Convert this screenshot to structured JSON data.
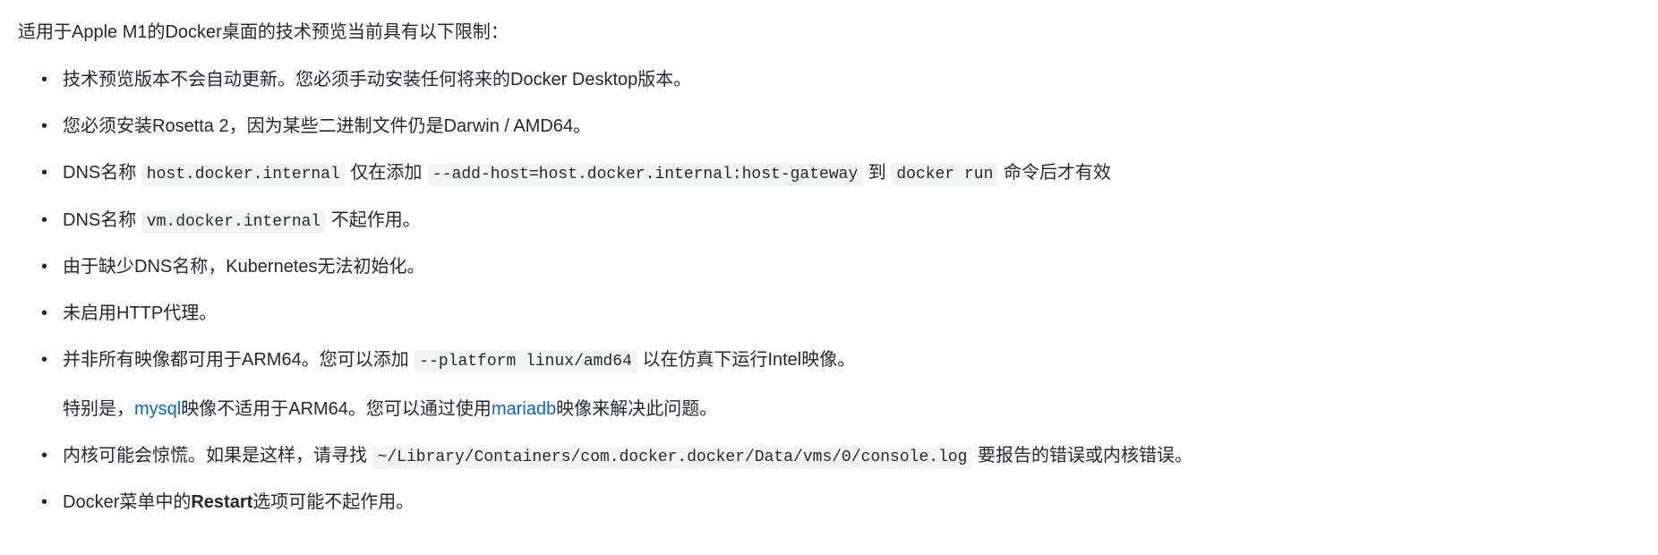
{
  "intro": "适用于Apple M1的Docker桌面的技术预览当前具有以下限制：",
  "items": [
    {
      "text": "技术预览版本不会自动更新。您必须手动安装任何将来的Docker Desktop版本。"
    },
    {
      "text": "您必须安装Rosetta 2，因为某些二进制文件仍是Darwin / AMD64。"
    },
    {
      "pre1": "DNS名称 ",
      "code1": "host.docker.internal",
      "mid1": " 仅在添加 ",
      "code2": "--add-host=host.docker.internal:host-gateway",
      "mid2": " 到 ",
      "code3": "docker run",
      "post": " 命令后才有效"
    },
    {
      "pre1": "DNS名称 ",
      "code1": "vm.docker.internal",
      "post": " 不起作用。"
    },
    {
      "text": "由于缺少DNS名称，Kubernetes无法初始化。"
    },
    {
      "text": "未启用HTTP代理。"
    },
    {
      "pre1": "并非所有映像都可用于ARM64。您可以添加 ",
      "code1": "--platform linux/amd64",
      "post": " 以在仿真下运行Intel映像。",
      "sub_pre": "特别是，",
      "sub_link1": "mysql",
      "sub_mid1": "映像不适用于ARM64。您可以通过使用",
      "sub_link2": "mariadb",
      "sub_post": "映像来解决此问题。"
    },
    {
      "pre1": "内核可能会惊慌。如果是这样，请寻找 ",
      "code1": "~/Library/Containers/com.docker.docker/Data/vms/0/console.log",
      "post": " 要报告的错误或内核错误。"
    },
    {
      "pre1": "Docker菜单中的",
      "strong1": "Restart",
      "post": "选项可能不起作用。"
    }
  ]
}
